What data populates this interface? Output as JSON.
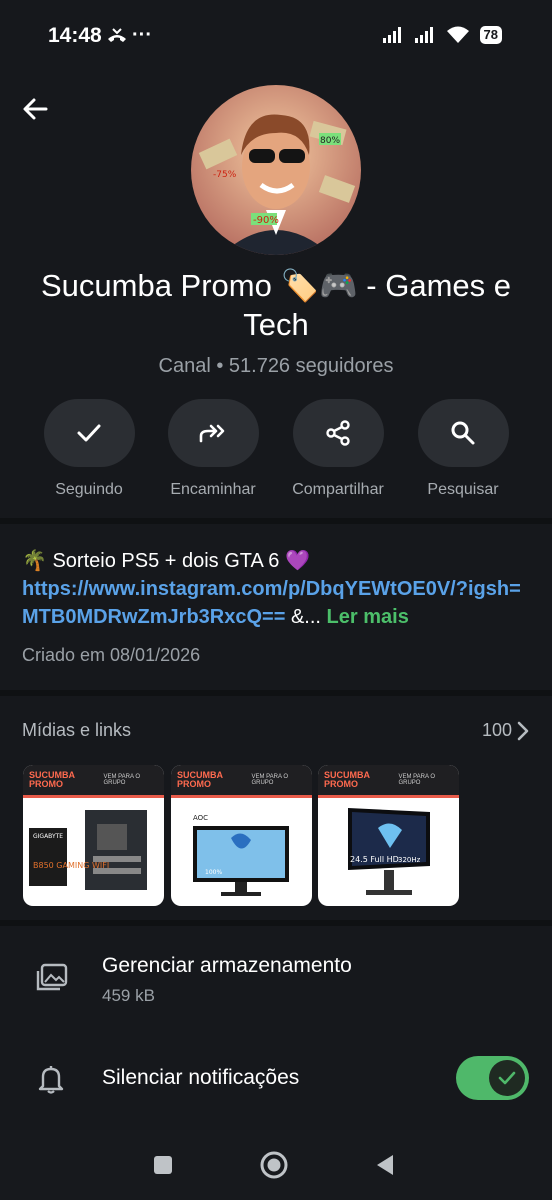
{
  "status_bar": {
    "time": "14:48",
    "battery": "78",
    "more": "···"
  },
  "channel": {
    "title": "Sucumba Promo 🏷️🎮  - Games e Tech",
    "subtitle": "Canal • 51.726 seguidores"
  },
  "actions": [
    {
      "label": "Seguindo",
      "icon": "check-icon"
    },
    {
      "label": "Encaminhar",
      "icon": "forward-icon"
    },
    {
      "label": "Compartilhar",
      "icon": "share-icon"
    },
    {
      "label": "Pesquisar",
      "icon": "search-icon"
    }
  ],
  "description": {
    "text": "🌴 Sorteio PS5 + dois GTA 6 💜",
    "link": "https://www.instagram.com/p/DbqYEWtOE0V/?igsh=MTB0MDRwZmJrb3RxcQ==",
    "suffix": " &...",
    "more": "Ler mais",
    "created": "Criado em 08/01/2026"
  },
  "media": {
    "title": "Mídias e links",
    "count": "100",
    "thumbs": [
      {
        "brand": "SUCUMBA PROMO",
        "caption": "VEM PARA O GRUPO",
        "product": "B850 GAMING WIFI",
        "badge": "GIGABYTE"
      },
      {
        "brand": "SUCUMBA PROMO",
        "caption": "VEM PARA O GRUPO",
        "product": "AOC",
        "badge": "100%"
      },
      {
        "brand": "SUCUMBA PROMO",
        "caption": "VEM PARA O GRUPO",
        "product": "24.5 Full HD",
        "badge": "320Hz"
      }
    ]
  },
  "storage": {
    "title": "Gerenciar armazenamento",
    "size": "459 kB"
  },
  "notifications": {
    "title": "Silenciar notificações",
    "toggle_on": true
  },
  "colors": {
    "background": "#16181c",
    "accent_green": "#4fb86a",
    "link_blue": "#5aa2e8"
  }
}
